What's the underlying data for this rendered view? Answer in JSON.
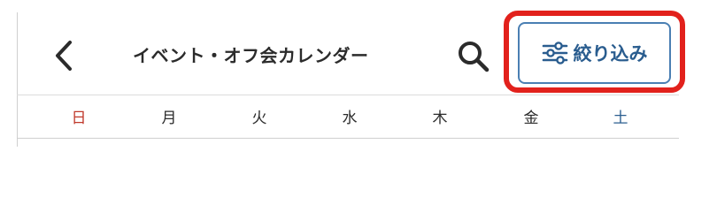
{
  "header": {
    "title": "イベント・オフ会カレンダー",
    "back_icon": "chevron-left-icon",
    "search_icon": "search-icon",
    "filter_button": {
      "label": "絞り込み",
      "icon": "sliders-icon"
    }
  },
  "weekdays": [
    {
      "label": "日",
      "color": "#c0392b"
    },
    {
      "label": "月",
      "color": "#2b2b2b"
    },
    {
      "label": "火",
      "color": "#2b2b2b"
    },
    {
      "label": "水",
      "color": "#2b2b2b"
    },
    {
      "label": "木",
      "color": "#2b2b2b"
    },
    {
      "label": "金",
      "color": "#2b2b2b"
    },
    {
      "label": "土",
      "color": "#2a5d8f"
    }
  ],
  "colors": {
    "accent": "#2a5d8f",
    "highlight": "#e2211c",
    "sunday": "#c0392b",
    "saturday": "#2a5d8f"
  }
}
